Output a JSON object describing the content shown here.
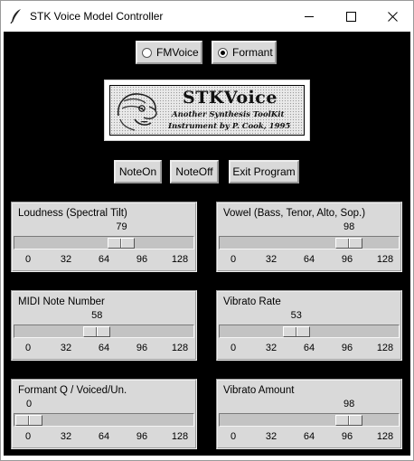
{
  "window": {
    "title": "STK Voice Model Controller",
    "controls": [
      "minimize-icon",
      "maximize-icon",
      "close-icon"
    ]
  },
  "mode": {
    "options": [
      {
        "label": "FMVoice",
        "selected": false
      },
      {
        "label": "Formant",
        "selected": true
      }
    ]
  },
  "logo": {
    "title": "STKVoice",
    "line1": "Another Synthesis ToolKit",
    "line2": "Instrument by P. Cook, 1995"
  },
  "actions": {
    "note_on": "NoteOn",
    "note_off": "NoteOff",
    "exit": "Exit Program"
  },
  "sliders": [
    {
      "label": "Loudness (Spectral Tilt)",
      "value": 79,
      "min": 0,
      "max": 128,
      "ticks": [
        "0",
        "32",
        "64",
        "96",
        "128"
      ]
    },
    {
      "label": "Vowel (Bass, Tenor, Alto, Sop.)",
      "value": 98,
      "min": 0,
      "max": 128,
      "ticks": [
        "0",
        "32",
        "64",
        "96",
        "128"
      ]
    },
    {
      "label": "MIDI Note Number",
      "value": 58,
      "min": 0,
      "max": 128,
      "ticks": [
        "0",
        "32",
        "64",
        "96",
        "128"
      ]
    },
    {
      "label": "Vibrato Rate",
      "value": 53,
      "min": 0,
      "max": 128,
      "ticks": [
        "0",
        "32",
        "64",
        "96",
        "128"
      ]
    },
    {
      "label": "Formant Q / Voiced/Un.",
      "value": 0,
      "min": 0,
      "max": 128,
      "ticks": [
        "0",
        "32",
        "64",
        "96",
        "128"
      ]
    },
    {
      "label": "Vibrato Amount",
      "value": 98,
      "min": 0,
      "max": 128,
      "ticks": [
        "0",
        "32",
        "64",
        "96",
        "128"
      ]
    }
  ]
}
